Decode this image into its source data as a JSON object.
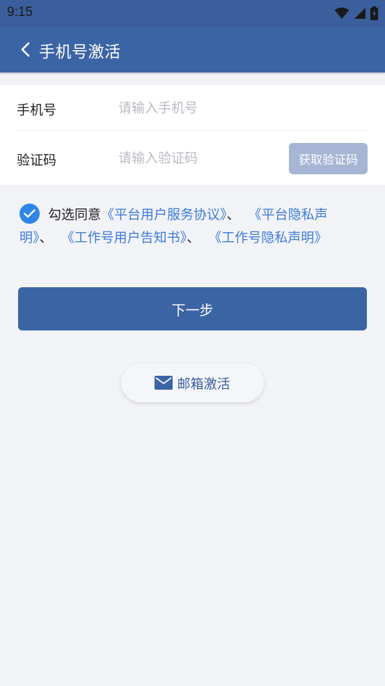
{
  "status_bar": {
    "time": "9:15"
  },
  "app_bar": {
    "title": "手机号激活"
  },
  "form": {
    "phone": {
      "label": "手机号",
      "placeholder": "请输入手机号",
      "value": ""
    },
    "code": {
      "label": "验证码",
      "placeholder": "请输入验证码",
      "value": "",
      "button_label": "获取验证码"
    }
  },
  "agreement": {
    "checked": true,
    "prefix": "勾选同意",
    "links": [
      "《平台用户服务协议》",
      "《平台隐私声明》",
      "《工作号用户告知书》",
      "《工作号隐私声明》"
    ],
    "separator": "、"
  },
  "next_button": {
    "label": "下一步"
  },
  "email_activation": {
    "label": "邮箱激活"
  },
  "colors": {
    "primary": "#3b64a4",
    "link": "#3e7bd6",
    "check": "#2f86e8",
    "sms_button": "#a6b5d3",
    "background": "#f2f3f7"
  }
}
